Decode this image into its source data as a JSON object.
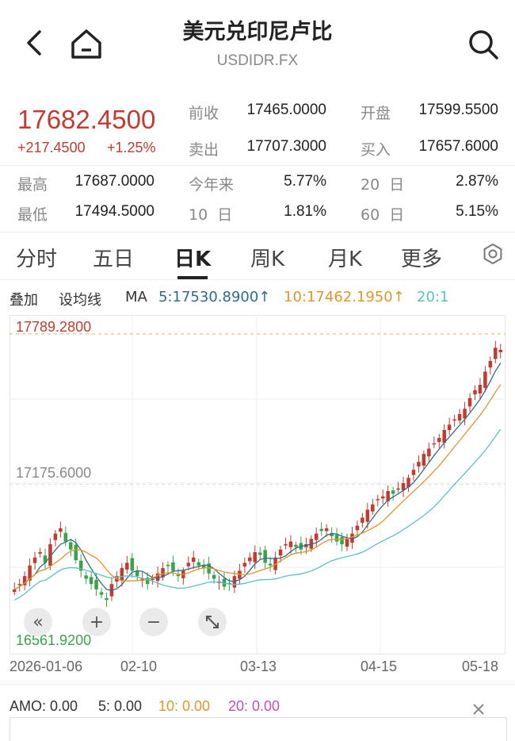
{
  "header": {
    "title": "美元兑印尼卢比",
    "symbol": "USDIDR.FX"
  },
  "quote": {
    "price": "17682.4500",
    "change": "+217.4500",
    "change_pct": "+1.25%",
    "stats": [
      {
        "label": "前收",
        "value": "17465.0000"
      },
      {
        "label": "开盘",
        "value": "17599.5500"
      },
      {
        "label": "卖出",
        "value": "17707.3000"
      },
      {
        "label": "买入",
        "value": "17657.6000"
      },
      {
        "label": "最高",
        "value": "17687.0000"
      },
      {
        "label": "今年来",
        "value": "5.77%"
      },
      {
        "label": "20  日",
        "value": "2.87%"
      },
      {
        "label": "最低",
        "value": "17494.5000"
      },
      {
        "label": "10  日",
        "value": "1.81%"
      },
      {
        "label": "60  日",
        "value": "5.15%"
      }
    ]
  },
  "tabs": [
    "分时",
    "五日",
    "日K",
    "周K",
    "月K",
    "更多"
  ],
  "active_tab": "日K",
  "indicator_bar": {
    "overlay": "叠加",
    "set_ma": "设均线",
    "ma": "MA",
    "ma5": "5:17530.8900↑",
    "ma10": "10:17462.1950↑",
    "ma20": "20:1"
  },
  "colors": {
    "up": "#c23b30",
    "down": "#3aa34a",
    "ma5": "#2e6c8e",
    "ma10": "#e0962b",
    "ma20": "#5bc0c7"
  },
  "chart_data": {
    "type": "candlestick",
    "ylim": [
      16561.92,
      17789.28
    ],
    "y_ticks": [
      "17789.2800",
      "17175.6000",
      "16561.9200"
    ],
    "x_ticks": [
      "2026-01-06",
      "02-10",
      "03-13",
      "04-15",
      "05-18"
    ],
    "close_series": [
      16780,
      16800,
      16830,
      16870,
      16900,
      16920,
      16880,
      16950,
      16990,
      17010,
      16960,
      16930,
      16890,
      16850,
      16820,
      16800,
      16780,
      16760,
      16740,
      16800,
      16830,
      16860,
      16880,
      16850,
      16830,
      16820,
      16800,
      16820,
      16840,
      16860,
      16870,
      16850,
      16830,
      16850,
      16880,
      16900,
      16870,
      16860,
      16840,
      16820,
      16810,
      16790,
      16800,
      16830,
      16850,
      16880,
      16900,
      16920,
      16910,
      16880,
      16870,
      16900,
      16930,
      16950,
      16960,
      16940,
      16930,
      16950,
      16970,
      16990,
      17000,
      17010,
      16980,
      16960,
      16950,
      16970,
      16990,
      17020,
      17050,
      17080,
      17100,
      17120,
      17130,
      17150,
      17140,
      17160,
      17180,
      17200,
      17230,
      17260,
      17290,
      17310,
      17330,
      17350,
      17380,
      17400,
      17420,
      17440,
      17460,
      17500,
      17530,
      17550,
      17600,
      17640,
      17690,
      17682
    ],
    "ma5_latest": "17530.8900",
    "ma10_latest": "17462.1950"
  },
  "chart_controls": [
    "rewind-icon",
    "zoom-in-icon",
    "zoom-out-icon",
    "fullscreen-icon"
  ],
  "amo_bar": {
    "amo": "AMO: 0.00",
    "v5": "5: 0.00",
    "v10": "10: 0.00",
    "v20": "20: 0.00"
  }
}
